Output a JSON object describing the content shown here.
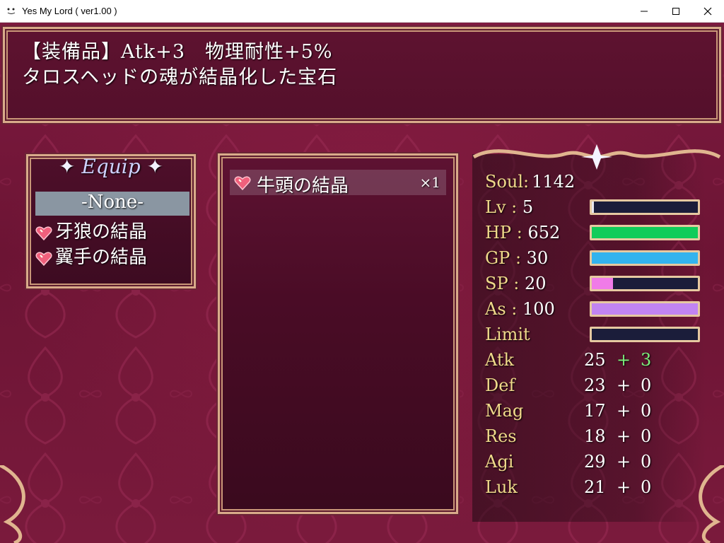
{
  "window": {
    "title": "Yes My Lord ( ver1.00 )",
    "buttons": [
      "minimize-icon",
      "maximize-icon",
      "close-icon"
    ]
  },
  "help": {
    "line1": "【装備品】Atk+3　物理耐性+5%",
    "line2": "タロスヘッドの魂が結晶化した宝石"
  },
  "equip": {
    "title": "Equip",
    "items": [
      {
        "label": "-None-",
        "selected": true
      },
      {
        "label": "牙狼の結晶",
        "icon": "heart-gem-icon"
      },
      {
        "label": "翼手の結晶",
        "icon": "heart-gem-icon"
      }
    ]
  },
  "item_list": {
    "items": [
      {
        "name": "牛頭の結晶",
        "count": "×1",
        "icon": "heart-gem-icon"
      }
    ]
  },
  "status": {
    "soul": {
      "label": "Soul",
      "value": "1142"
    },
    "gauges": [
      {
        "label": "Lv",
        "value": "5",
        "fill": 0.02,
        "color": "#e8e8f0"
      },
      {
        "label": "HP",
        "value": "652",
        "fill": 1.0,
        "color": "#10cc5a"
      },
      {
        "label": "GP",
        "value": "30",
        "fill": 1.0,
        "color": "#33b3ee"
      },
      {
        "label": "SP",
        "value": "20",
        "fill": 0.2,
        "color": "#f07be8"
      },
      {
        "label": "As",
        "value": "100",
        "fill": 1.0,
        "color": "#c184f2"
      },
      {
        "label": "Limit",
        "value": "",
        "fill": 0.0,
        "color": "#1b1d3a"
      }
    ],
    "stats": [
      {
        "label": "Atk",
        "base": "25",
        "plus": "+",
        "bonus": "3",
        "highlight": true
      },
      {
        "label": "Def",
        "base": "23",
        "plus": "+",
        "bonus": "0"
      },
      {
        "label": "Mag",
        "base": "17",
        "plus": "+",
        "bonus": "0"
      },
      {
        "label": "Res",
        "base": "18",
        "plus": "+",
        "bonus": "0"
      },
      {
        "label": "Agi",
        "base": "29",
        "plus": "+",
        "bonus": "0"
      },
      {
        "label": "Luk",
        "base": "21",
        "plus": "+",
        "bonus": "0"
      }
    ]
  },
  "colors": {
    "background": "#6e1535",
    "frame_gold": "#d9ab8a",
    "label_gold": "#f0d98a",
    "bonus_green": "#7cf07c"
  }
}
